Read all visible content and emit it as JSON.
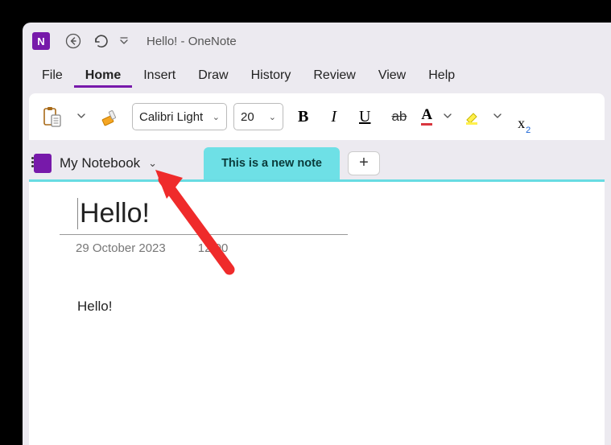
{
  "title": {
    "document": "Hello!",
    "sep": " - ",
    "app": "OneNote"
  },
  "menu": {
    "items": [
      "File",
      "Home",
      "Insert",
      "Draw",
      "History",
      "Review",
      "View",
      "Help"
    ],
    "active_index": 1
  },
  "ribbon": {
    "font_name": "Calibri Light",
    "font_size": "20",
    "bold": "B",
    "italic": "I",
    "underline": "U",
    "strike": "ab",
    "fontcolor_glyph": "A",
    "subscript_x": "x",
    "subscript_2": "2"
  },
  "notebook": {
    "name": "My Notebook"
  },
  "tabs": {
    "active_label": "This is a new note",
    "add_glyph": "+"
  },
  "page": {
    "title": "Hello!",
    "date": "29 October 2023",
    "time": "12:00",
    "body": "Hello!"
  }
}
